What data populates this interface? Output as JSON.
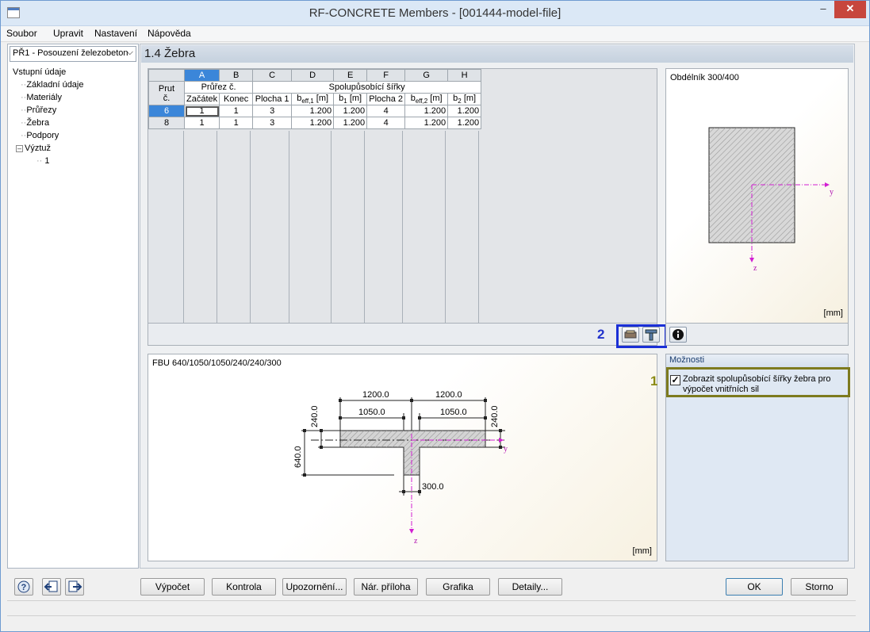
{
  "window": {
    "title": "RF-CONCRETE Members - [001444-model-file]",
    "minimize": "–",
    "close": "✕"
  },
  "menu": [
    "Soubor",
    "Upravit",
    "Nastavení",
    "Nápověda"
  ],
  "sidebar": {
    "dropdown": "PŘ1 - Posouzení železobeton",
    "tree": {
      "root": "Vstupní údaje",
      "items": [
        "Základní údaje",
        "Materiály",
        "Průřezy",
        "Žebra",
        "Podpory"
      ],
      "group": "Výztuž",
      "group_child": "1",
      "expander": "–"
    }
  },
  "page_title": "1.4 Žebra",
  "table": {
    "col_letters": [
      "A",
      "B",
      "C",
      "D",
      "E",
      "F",
      "G",
      "H"
    ],
    "prut_header": "Prut",
    "prut_header2": "č.",
    "group1": "Průřez č.",
    "group2": "Spolupůsobící šířky",
    "sub": {
      "a": "Začátek",
      "b": "Konec",
      "c": "Plocha 1",
      "d_main": "b",
      "d_sub": "eff,1",
      "d_unit": "[m]",
      "e_main": "b",
      "e_sub": "1",
      "e_unit": "[m]",
      "f": "Plocha 2",
      "g_main": "b",
      "g_sub": "eff,2",
      "g_unit": "[m]",
      "h_main": "b",
      "h_sub": "2",
      "h_unit": "[m]"
    },
    "rows": [
      {
        "prut": "6",
        "a": "1",
        "b": "1",
        "c": "3",
        "d": "1.200",
        "e": "1.200",
        "f": "4",
        "g": "1.200",
        "h": "1.200"
      },
      {
        "prut": "8",
        "a": "1",
        "b": "1",
        "c": "3",
        "d": "1.200",
        "e": "1.200",
        "f": "4",
        "g": "1.200",
        "h": "1.200"
      }
    ]
  },
  "callout2": "2",
  "callout1": "1",
  "section_preview": {
    "label": "Obdélník 300/400",
    "unit": "[mm]",
    "axis_y": "y",
    "axis_z": "z"
  },
  "tbeam_preview": {
    "label": "FBU 640/1050/1050/240/240/300",
    "unit": "[mm]",
    "dims": {
      "beff1": "1200.0",
      "beff2": "1200.0",
      "b1": "1050.0",
      "b2": "1050.0",
      "hf_left": "240.0",
      "hf_right": "240.0",
      "h": "640.0",
      "bw": "300.0"
    },
    "axis_y": "y",
    "axis_z": "z"
  },
  "options": {
    "header": "Možnosti",
    "checkbox_mark": "✓",
    "checkbox_label": "Zobrazit spolupůsobící šířky žebra pro výpočet vnitřních sil"
  },
  "buttons": {
    "calc": "Výpočet",
    "check": "Kontrola",
    "warnings": "Upozornění...",
    "annex": "Nár. příloha",
    "graphics": "Grafika",
    "details": "Detaily...",
    "ok": "OK",
    "cancel": "Storno"
  },
  "colors": {
    "accent": "#3b86d9",
    "callout_blue": "#1a2fd6",
    "callout_olive": "#7d7a1e",
    "axis": "#d21ed2"
  }
}
